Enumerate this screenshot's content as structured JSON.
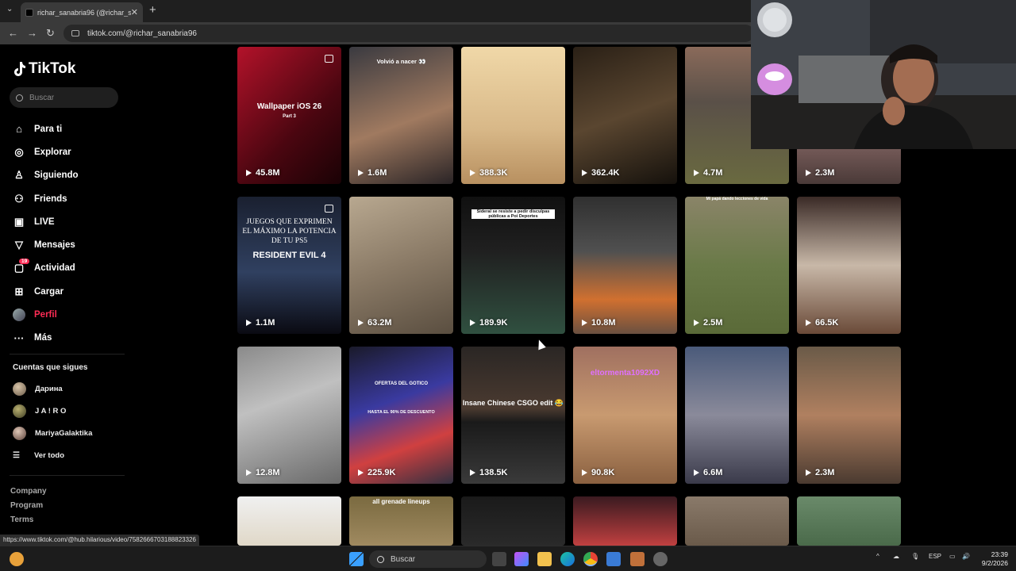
{
  "browser": {
    "tab_title": "richar_sanabria96 (@richar_sanabria96)",
    "url": "tiktok.com/@richar_sanabria96",
    "status_url": "https://www.tiktok.com/@hub.hilarious/video/7582666703188823326"
  },
  "sidebar": {
    "logo": "TikTok",
    "search_placeholder": "Buscar",
    "nav": [
      {
        "label": "Para ti",
        "icon": "home-icon"
      },
      {
        "label": "Explorar",
        "icon": "compass-icon"
      },
      {
        "label": "Siguiendo",
        "icon": "following-icon"
      },
      {
        "label": "Friends",
        "icon": "friends-icon"
      },
      {
        "label": "LIVE",
        "icon": "live-icon"
      },
      {
        "label": "Mensajes",
        "icon": "messages-icon"
      },
      {
        "label": "Actividad",
        "icon": "activity-icon",
        "badge": "19"
      },
      {
        "label": "Cargar",
        "icon": "upload-icon"
      },
      {
        "label": "Perfil",
        "icon": "profile-avatar",
        "active": true
      },
      {
        "label": "Más",
        "icon": "more-icon"
      }
    ],
    "following_title": "Cuentas que sigues",
    "following": [
      {
        "name": "Дарина"
      },
      {
        "name": "J A ! R O"
      },
      {
        "name": "MariyaGalaktika"
      }
    ],
    "see_all": "Ver todo",
    "footer": [
      "Company",
      "Program",
      "Terms"
    ]
  },
  "grid": {
    "rows": [
      [
        {
          "views": "45.8M",
          "caption": "Wallpaper iOS 26",
          "caption2": "Part 3"
        },
        {
          "views": "1.6M",
          "caption": "Volvió a nacer 👀"
        },
        {
          "views": "388.3K"
        },
        {
          "views": "362.4K"
        },
        {
          "views": "4.7M"
        },
        {
          "views": "2.3M"
        }
      ],
      [
        {
          "views": "1.1M",
          "caption": "JUEGOS QUE EXPRIMEN EL MÁXIMO LA POTENCIA DE TU PS5",
          "caption2": "RESIDENT EVIL 4"
        },
        {
          "views": "63.2M"
        },
        {
          "views": "189.9K",
          "caption": "Sideral se resiste a pedir disculpas públicas a Poi Deportes"
        },
        {
          "views": "10.8M"
        },
        {
          "views": "2.5M",
          "caption": "Mi papá dando lecciones de vida"
        },
        {
          "views": "66.5K"
        }
      ],
      [
        {
          "views": "12.8M"
        },
        {
          "views": "225.9K",
          "caption": "OFERTAS DEL GOTICO",
          "caption2": "HASTA EL 90% DE DESCUENTO"
        },
        {
          "views": "138.5K",
          "caption": "Insane Chinese CSGO edit 😂"
        },
        {
          "views": "90.8K",
          "caption": "eltormenta1092XD"
        },
        {
          "views": "6.6M"
        },
        {
          "views": "2.3M"
        }
      ],
      [
        {
          "views": ""
        },
        {
          "views": "",
          "caption": "all grenade lineups"
        },
        {
          "views": ""
        },
        {
          "views": ""
        },
        {
          "views": ""
        },
        {
          "views": ""
        }
      ]
    ]
  },
  "taskbar": {
    "search": "Buscar",
    "lang": "ESP",
    "time": "23:39",
    "date": "9/2/2026"
  }
}
